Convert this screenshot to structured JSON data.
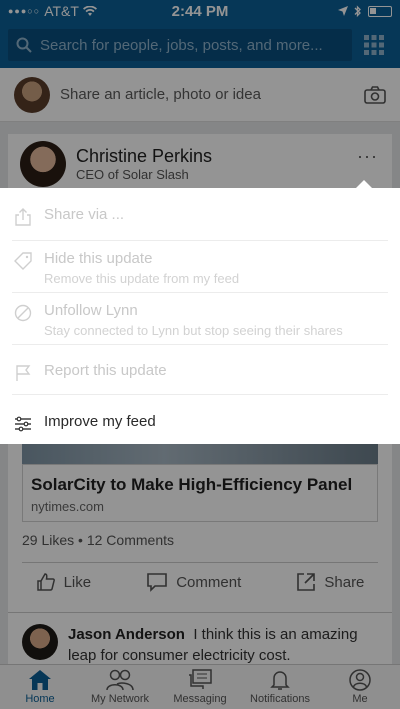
{
  "status": {
    "carrier": "AT&T",
    "time": "2:44 PM"
  },
  "search": {
    "placeholder": "Search for people, jobs, posts, and more..."
  },
  "share": {
    "prompt": "Share an article, photo or idea"
  },
  "post": {
    "author": "Christine Perkins",
    "headline": "CEO of Solar Slash",
    "more": "···",
    "article_title": "SolarCity to Make High-Efficiency Panel",
    "article_source": "nytimes.com",
    "likes": "29 Likes",
    "comments": "12 Comments",
    "actions": {
      "like": "Like",
      "comment": "Comment",
      "share": "Share"
    },
    "comment_author": "Jason Anderson",
    "comment_text": "I think this is an amazing leap for consumer electricity cost."
  },
  "menu": {
    "items": [
      {
        "label": "Share via ...",
        "icon": "share-icon",
        "enabled": false
      },
      {
        "label": "Hide this update",
        "sub": "Remove this update from my feed",
        "icon": "tag-icon",
        "enabled": false
      },
      {
        "label": "Unfollow Lynn",
        "sub": "Stay connected to Lynn but stop seeing their shares",
        "icon": "block-icon",
        "enabled": false
      },
      {
        "label": "Report this update",
        "icon": "flag-icon",
        "enabled": false
      },
      {
        "label": "Improve my feed",
        "icon": "sliders-icon",
        "enabled": true
      }
    ]
  },
  "tabs": [
    {
      "label": "Home",
      "icon": "home-icon",
      "active": true
    },
    {
      "label": "My Network",
      "icon": "network-icon"
    },
    {
      "label": "Messaging",
      "icon": "messaging-icon"
    },
    {
      "label": "Notifications",
      "icon": "bell-icon"
    },
    {
      "label": "Me",
      "icon": "profile-icon"
    }
  ],
  "colors": {
    "brand": "#0c6097",
    "overlay": "rgba(0,0,0,0.42)"
  }
}
